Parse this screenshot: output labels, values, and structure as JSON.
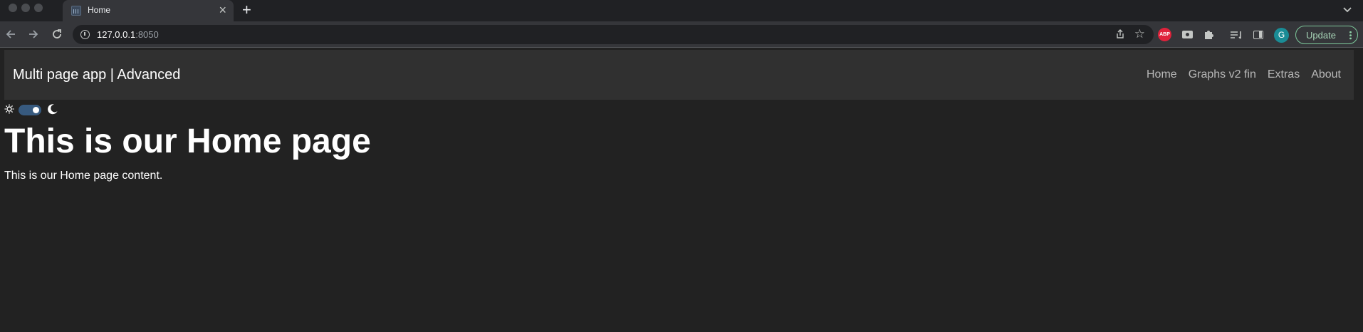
{
  "browser": {
    "tab": {
      "title": "Home"
    },
    "address": {
      "host": "127.0.0.1",
      "port": ":8050"
    },
    "extensions": {
      "abp_label": "ABP"
    },
    "profile_initial": "G",
    "update_label": "Update"
  },
  "navbar": {
    "brand": "Multi page app | Advanced",
    "links": [
      "Home",
      "Graphs v2 fin",
      "Extras",
      "About"
    ]
  },
  "theme_switch": {
    "state": "on"
  },
  "main": {
    "heading": "This is our Home page",
    "text": "This is our Home page content."
  },
  "colors": {
    "page_bg": "#222222",
    "navbar_bg": "#303030",
    "toggle_accent": "#375a7f",
    "abp_red": "#e0223b",
    "avatar_teal": "#1a8c96",
    "update_green": "#7cc79a"
  }
}
